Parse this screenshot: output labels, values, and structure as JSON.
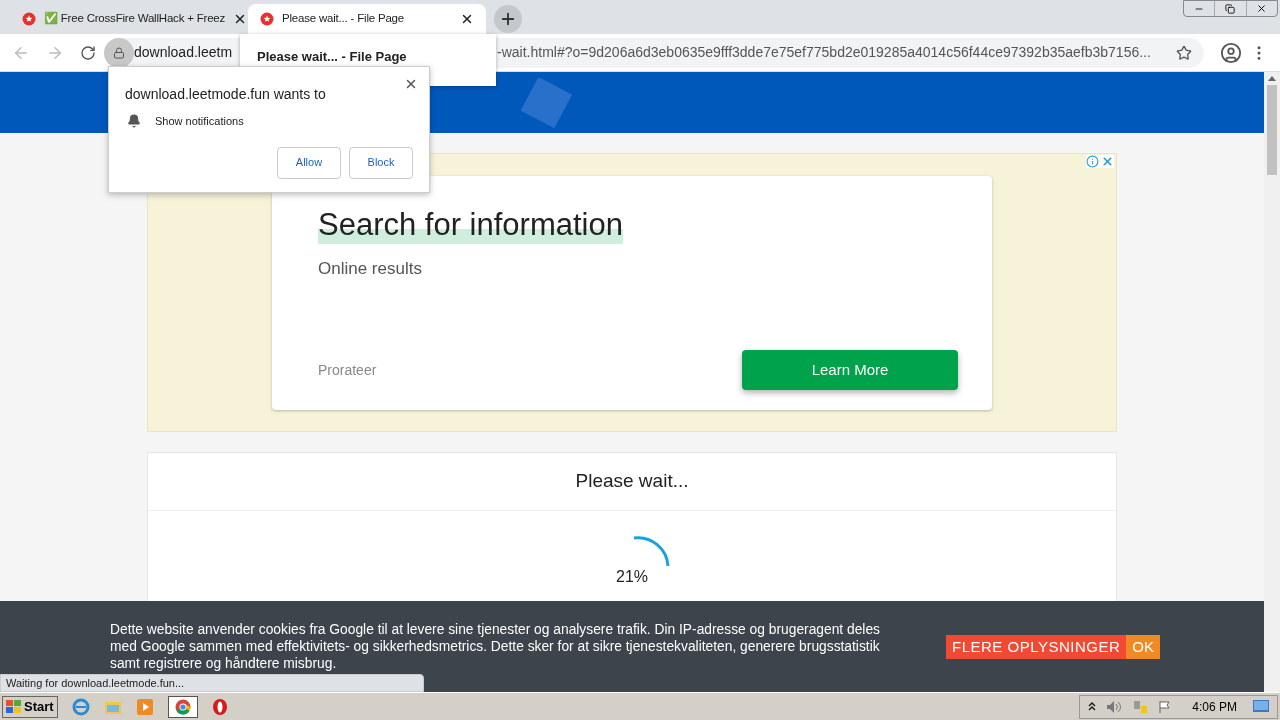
{
  "tabs": [
    {
      "title": "✅ Free CrossFire WallHack + Freez",
      "selected": false
    },
    {
      "title": "Please wait... - File Page",
      "selected": true
    }
  ],
  "hover_card": {
    "title": "Please wait... - File Page"
  },
  "address_bar": {
    "host": "download.leetm",
    "rest": "-wait.html#?o=9d206a6d3eb0635e9fff3dde7e75ef775bd2e019285a4014c56f44ce97392b35aefb3b7156..."
  },
  "permission_popup": {
    "title": "download.leetmode.fun wants to",
    "permission": "Show notifications",
    "buttons": [
      "Allow",
      "Block"
    ]
  },
  "ad": {
    "headline": "Search for information",
    "subtitle": "Online results",
    "advertiser": "Prorateer",
    "cta": "Learn More"
  },
  "wait_panel": {
    "title": "Please wait...",
    "progress": "21%"
  },
  "cookie_banner": {
    "text": "Dette website anvender cookies fra Google til at levere sine tjenester og analysere trafik. Din IP-adresse og brugeragent deles med Google sammen med effektivitets- og sikkerhedsmetrics. Dette sker for at sikre tjenestekvaliteten, generere brugsstatistik samt registrere og håndtere misbrug.",
    "more_button": "FLERE OPLYSNINGER",
    "ok_button": "OK"
  },
  "status_bubble": "Waiting for download.leetmode.fun...",
  "taskbar": {
    "start": "Start",
    "clock": "4:06 PM"
  }
}
